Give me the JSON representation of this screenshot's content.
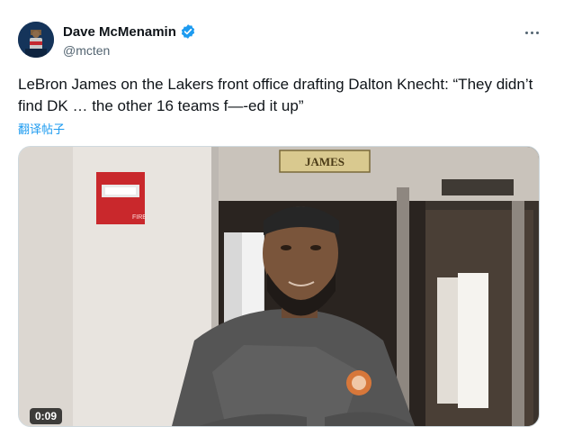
{
  "author": {
    "display_name": "Dave McMenamin",
    "handle": "@mcten",
    "avatar_icon": "avatar-photo",
    "verified_icon": "verified-badge-icon",
    "verified_color": "#1d9bf0"
  },
  "tweet": {
    "text": "LeBron James on the Lakers front office drafting Dalton Knecht: “They didn’t find DK … the other 16 teams f—-ed it up”",
    "translate_label": "翻译帖子"
  },
  "media": {
    "type": "video",
    "timestamp": "0:09",
    "locker_nameplate": "JAMES",
    "fire_alarm_label": "FIRE"
  },
  "colors": {
    "link": "#1d9bf0",
    "secondary_text": "#536471",
    "text": "#0f1419"
  }
}
